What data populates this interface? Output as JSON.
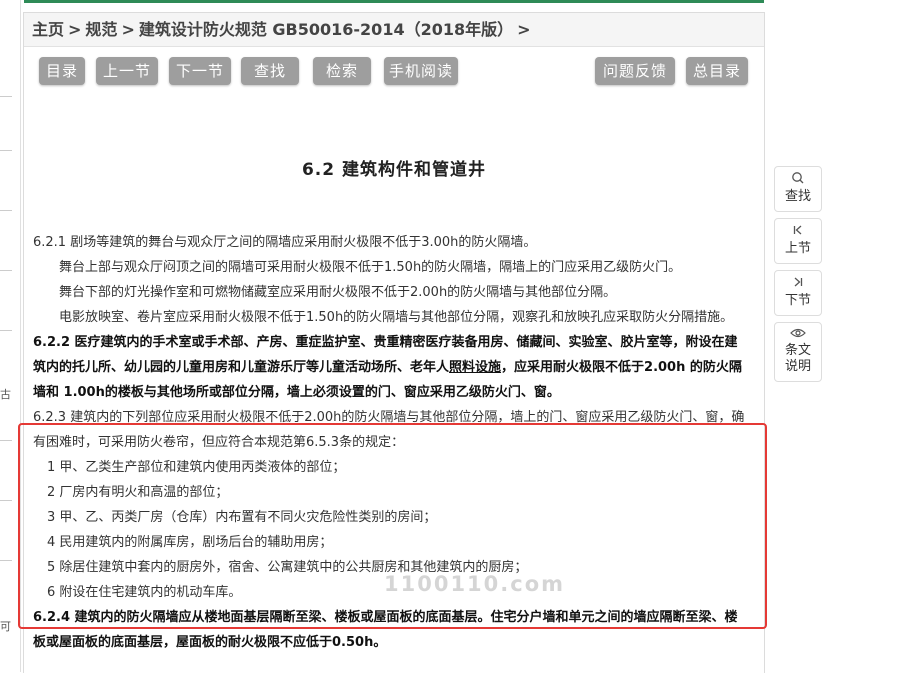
{
  "breadcrumb": {
    "home": "主页",
    "sep1": ">",
    "level2": "规范",
    "sep2": ">",
    "current": "建筑设计防火规范 GB50016-2014（2018年版）",
    "sep3": ">"
  },
  "toolbar": {
    "toc": "目录",
    "prev": "上一节",
    "next": "下一节",
    "find": "查找",
    "search": "检索",
    "mobile": "手机阅读",
    "feedback": "问题反馈",
    "master_toc": "总目录"
  },
  "section_title": "6.2  建筑构件和管道井",
  "clauses": {
    "c621": {
      "p1": "6.2.1 剧场等建筑的舞台与观众厅之间的隔墙应采用耐火极限不低于3.00h的防火隔墙。",
      "p2": "舞台上部与观众厅闷顶之间的隔墙可采用耐火极限不低于1.50h的防火隔墙，隔墙上的门应采用乙级防火门。",
      "p3": "舞台下部的灯光操作室和可燃物储藏室应采用耐火极限不低于2.00h的防火隔墙与其他部位分隔。",
      "p4": "电影放映室、卷片室应采用耐火极限不低于1.50h的防火隔墙与其他部位分隔，观察孔和放映孔应采取防火分隔措施。"
    },
    "c622": {
      "a": "6.2.2 医疗建筑内的手术室或手术部、产房、重症监护室、贵重精密医疗装备用房、储藏间、实验室、胶片室等，附设在建筑内的托儿所、幼儿园的儿童用房和儿童游乐厅等儿童活动场所、老年人",
      "u": "照料设施",
      "b": "，应采用耐火极限不低于2.00h 的防火隔墙和 1.00h的楼板与其他场所或部位分隔，墙上必须设置的门、窗应采用乙级防火门、窗。"
    },
    "c623": {
      "intro": "6.2.3 建筑内的下列部位应采用耐火极限不低于2.00h的防火隔墙与其他部位分隔，墙上的门、窗应采用乙级防火门、窗，确有困难时，可采用防火卷帘，但应符合本规范第6.5.3条的规定：",
      "items": [
        "1 甲、乙类生产部位和建筑内使用丙类液体的部位；",
        "2 厂房内有明火和高温的部位；",
        "3 甲、乙、丙类厂房（仓库）内布置有不同火灾危险性类别的房间；",
        "4 民用建筑内的附属库房，剧场后台的辅助用房；",
        "5 除居住建筑中套内的厨房外，宿舍、公寓建筑中的公共厨房和其他建筑内的厨房；",
        "6 附设在住宅建筑内的机动车库。"
      ]
    },
    "c624": "6.2.4 建筑内的防火隔墙应从楼地面基层隔断至梁、楼板或屋面板的底面基层。住宅分户墙和单元之间的墙应隔断至梁、楼板或屋面板的底面基层，屋面板的耐火极限不应低于0.50h。"
  },
  "watermark": "1100110.com",
  "side_panel": {
    "find": "查找",
    "prev": "上节",
    "next": "下节",
    "explain_1": "条文",
    "explain_2": "说明"
  },
  "left_glyphs": [
    "古",
    "可"
  ],
  "colors": {
    "button_bg": "#9e9e9e",
    "highlight_border": "#e53935",
    "top_accent": "#2e8b57"
  },
  "icons": {
    "find": "search-icon",
    "prev": "skip-back-icon",
    "next": "skip-forward-icon",
    "explain": "eye-icon"
  }
}
